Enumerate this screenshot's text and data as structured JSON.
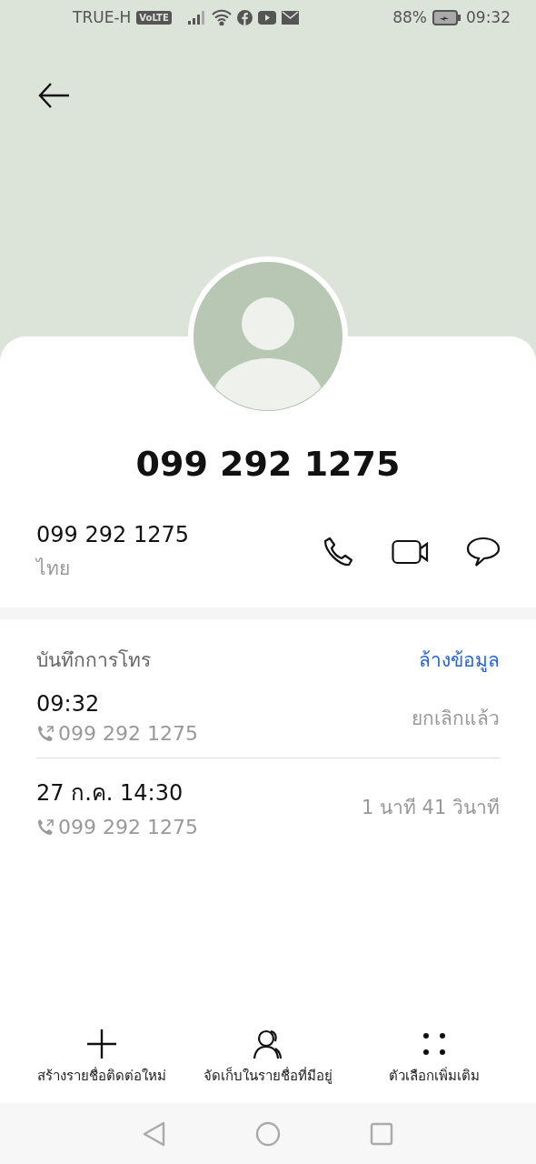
{
  "status_bar": {
    "carrier": "TRUE-H",
    "volte": "VoLTE",
    "battery_percent": "88%",
    "time": "09:32"
  },
  "contact": {
    "title": "099 292 1275",
    "number": "099 292 1275",
    "label": "ไทย"
  },
  "call_log": {
    "title": "บันทึกการโทร",
    "clear_label": "ล้างข้อมูล",
    "entries": [
      {
        "time": "09:32",
        "number": "099 292 1275",
        "detail": "ยกเลิกแล้ว"
      },
      {
        "time": "27 ก.ค. 14:30",
        "number": "099 292 1275",
        "detail": "1 นาที 41 วินาที"
      }
    ]
  },
  "actions": [
    {
      "kind": "add",
      "label": "สร้างรายชื่อติดต่อใหม่"
    },
    {
      "kind": "save",
      "label": "จัดเก็บในรายชื่อที่มีอยู่"
    },
    {
      "kind": "more",
      "label": "ตัวเลือกเพิ่มเติม"
    }
  ]
}
